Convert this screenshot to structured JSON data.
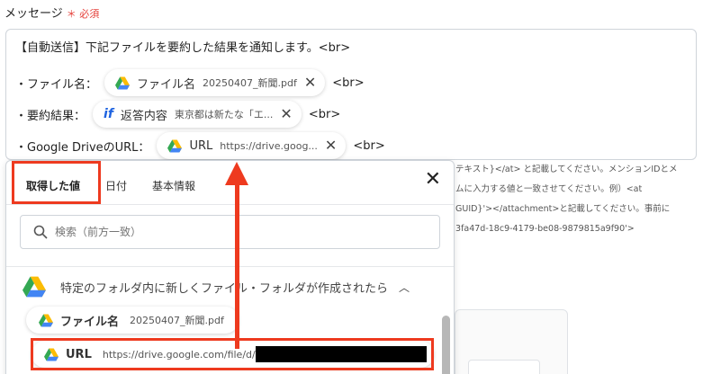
{
  "field": {
    "label": "メッセージ",
    "required": "＊ 必須"
  },
  "message": {
    "line1": "【自動送信】下記ファイルを要約した結果を通知します。<br>",
    "line2": {
      "prefix": "・ファイル名：",
      "chip_name": "ファイル名",
      "chip_value": "20250407_新聞.pdf",
      "suffix": "<br>"
    },
    "line3": {
      "prefix": "・要約結果：",
      "chip_name": "返答内容",
      "chip_value": "東京都は新たな「エ...",
      "suffix": "<br>"
    },
    "line4": {
      "prefix": "・Google DriveのURL：",
      "chip_name": "URL",
      "chip_value": "https://drive.goog...",
      "suffix": "<br>"
    }
  },
  "help": {
    "line1": "テキスト}</at> と記載してください。メンションIDとメ",
    "line2": "ムに入力する値と一致させてください。例）<at",
    "line3": "GUID}'></attachment>と記載してください。事前に",
    "line4": "3fa47d-18c9-4179-be08-9879815a9f90'>"
  },
  "popup": {
    "tabs": [
      "取得した値",
      "日付",
      "基本情報"
    ],
    "search_placeholder": "検索（前方一致）",
    "group_title": "特定のフォルダ内に新しくファイル・フォルダが作成されたら",
    "items": [
      {
        "name": "ファイル名",
        "value": "20250407_新聞.pdf"
      },
      {
        "name": "URL",
        "value": "https://drive.google.com/file/d/"
      }
    ]
  },
  "icons": {
    "drive": "google-drive-icon",
    "yoom": "yoom-if-icon",
    "close": "close-icon",
    "search": "search-icon",
    "chevron": "chevron-up-icon"
  },
  "colors": {
    "highlight": "#ee3a1f",
    "required": "#e5413b"
  }
}
